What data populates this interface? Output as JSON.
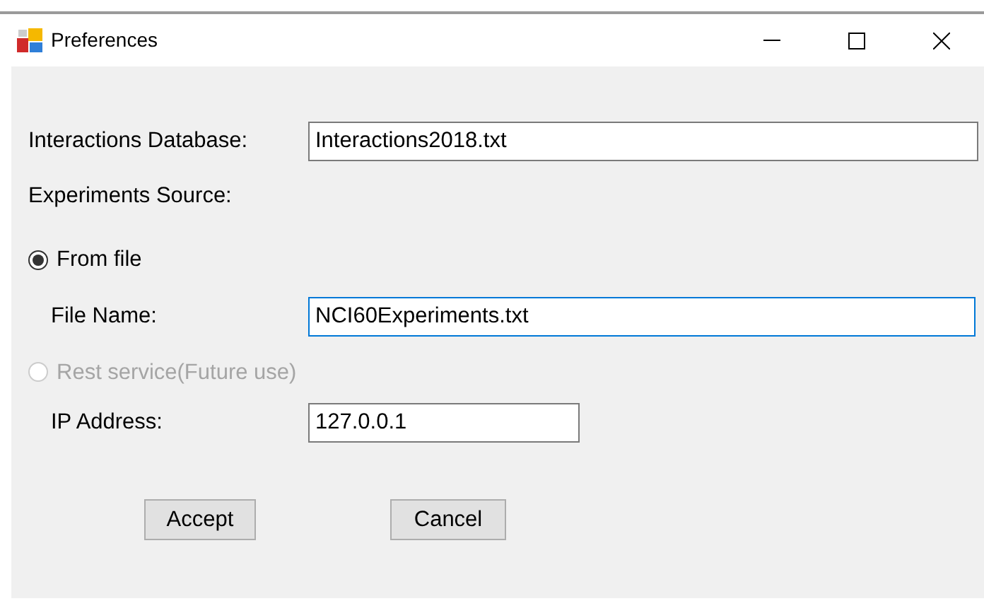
{
  "window": {
    "title": "Preferences"
  },
  "database": {
    "label": "Interactions Database:",
    "value": "Interactions2018.txt",
    "focused": false
  },
  "source_label": "Experiments Source:",
  "sources": [
    {
      "label": "From file",
      "selected": true,
      "disabled": false,
      "field": {
        "label": "File Name:",
        "value": "NCI60Experiments.txt",
        "focused": true
      }
    },
    {
      "label": "Rest service(Future use)",
      "selected": false,
      "disabled": true,
      "field": {
        "label": "IP Address:",
        "value": "127.0.0.1",
        "focused": false
      }
    }
  ],
  "buttons": [
    "Accept",
    "Cancel"
  ]
}
